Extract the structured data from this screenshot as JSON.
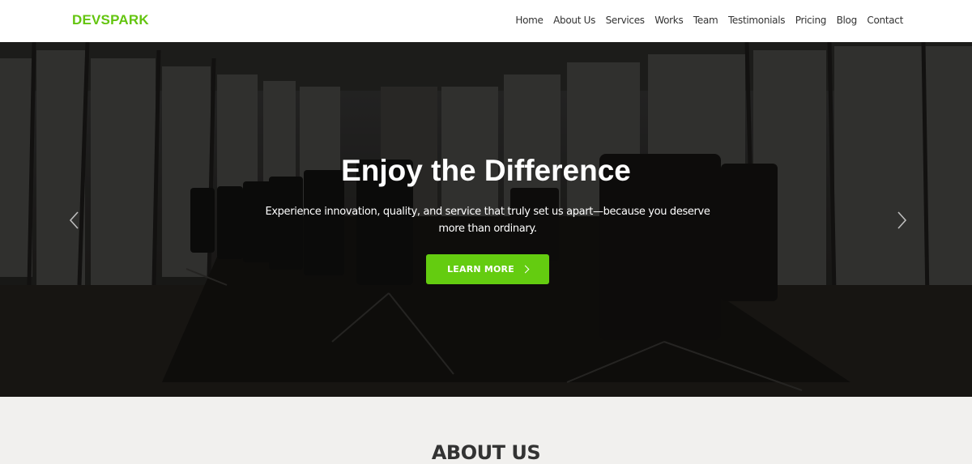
{
  "brand": {
    "name": "DEVSPARK",
    "color": "#64c510"
  },
  "nav": {
    "items": [
      "Home",
      "About Us",
      "Services",
      "Works",
      "Team",
      "Testimonials",
      "Pricing",
      "Blog",
      "Contact"
    ]
  },
  "hero": {
    "title": "Enjoy the Difference",
    "subtitle": "Experience innovation, quality, and service that truly set us apart—because you deserve more than ordinary.",
    "cta": {
      "label": "LEARN MORE",
      "icon": "chevron-right-icon",
      "color": "#64cc10"
    },
    "prev_icon": "chevron-left-icon",
    "next_icon": "chevron-right-icon"
  },
  "about": {
    "title": "ABOUT US"
  }
}
